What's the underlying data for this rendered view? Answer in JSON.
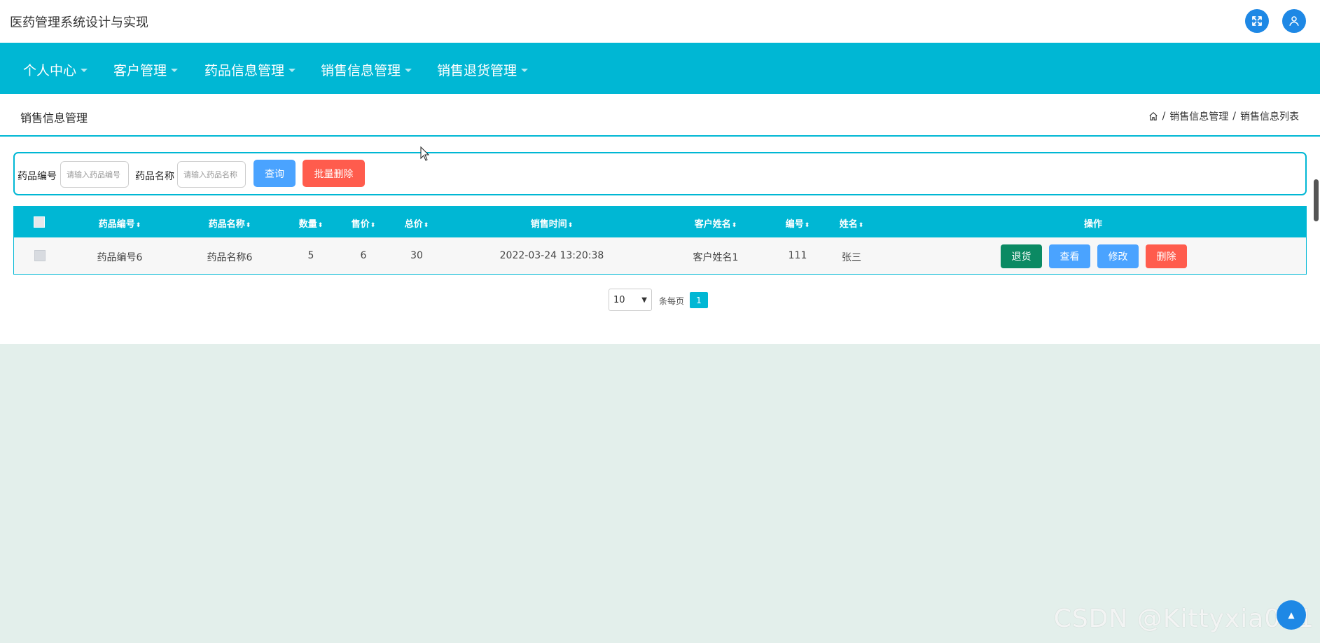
{
  "app": {
    "title": "医药管理系统设计与实现"
  },
  "header": {
    "fullscreen_icon": "expand-icon",
    "user_icon": "user-icon"
  },
  "nav": {
    "items": [
      {
        "label": "个人中心"
      },
      {
        "label": "客户管理"
      },
      {
        "label": "药品信息管理"
      },
      {
        "label": "销售信息管理"
      },
      {
        "label": "销售退货管理"
      }
    ]
  },
  "page": {
    "title": "销售信息管理",
    "breadcrumb": [
      "/",
      "销售信息管理",
      "/",
      "销售信息列表"
    ]
  },
  "search": {
    "code_label": "药品编号",
    "code_placeholder": "请输入药品编号",
    "name_label": "药品名称",
    "name_placeholder": "请输入药品名称",
    "query_button": "查询",
    "batch_delete_button": "批量删除"
  },
  "table": {
    "headers": [
      "药品编号",
      "药品名称",
      "数量",
      "售价",
      "总价",
      "销售时间",
      "客户姓名",
      "编号",
      "姓名",
      "操作"
    ],
    "sort_symbol": "⬍",
    "rows": [
      {
        "code": "药品编号6",
        "name": "药品名称6",
        "qty": "5",
        "price": "6",
        "total": "30",
        "time": "2022-03-24 13:20:38",
        "customer": "客户姓名1",
        "id": "111",
        "person": "张三",
        "actions": [
          "退货",
          "查看",
          "修改",
          "删除"
        ]
      }
    ]
  },
  "pager": {
    "page_size": "10",
    "per_page_label": "条每页",
    "current_page": "1"
  },
  "watermark": "CSDN @Kittyxia001",
  "colors": {
    "primary": "#00b7d4",
    "blue": "#4aa3ff",
    "danger": "#ff5c4d",
    "success": "#0b8a63"
  }
}
